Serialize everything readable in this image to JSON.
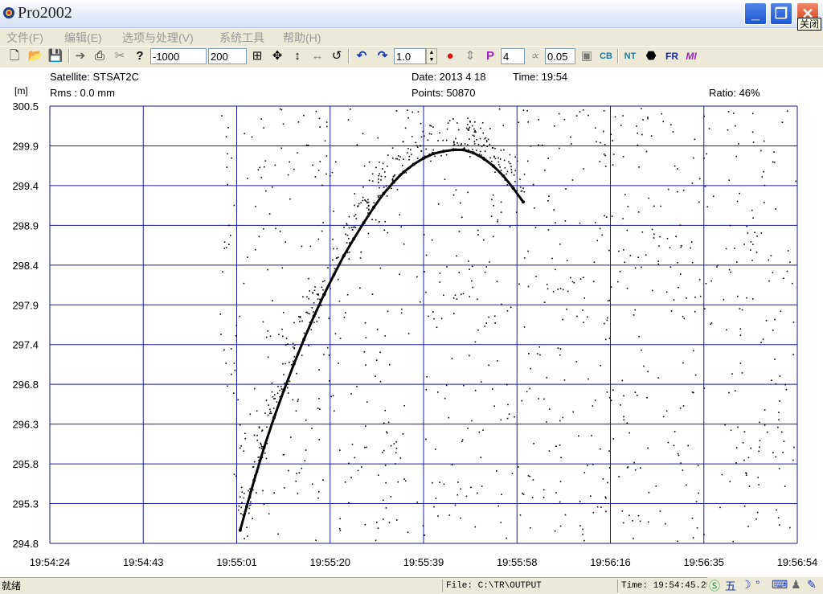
{
  "window": {
    "title": "Pro2002",
    "close_tooltip": "关闭"
  },
  "menu": [
    {
      "label": "文件(F)"
    },
    {
      "label": "编辑(E)"
    },
    {
      "label": "选项与处理(V)"
    },
    {
      "label": "系统工具"
    },
    {
      "label": "帮助(H)"
    }
  ],
  "toolbar": {
    "start_value": "-1000",
    "range_value": "200",
    "step_value": "1.0",
    "p_value": "4",
    "tolerance_value": "0.05",
    "icons": [
      "new-icon",
      "open-icon",
      "save-icon",
      "forward-icon",
      "print-icon",
      "cut-icon",
      "help-icon",
      "zoom-fit-icon",
      "pan-icon",
      "vertical-scale-icon",
      "horizontal-scale-icon",
      "rotate-icon",
      "undo-icon",
      "redo-icon",
      "record-dot-icon",
      "vertical-move-icon",
      "p-label-icon",
      "x-icon",
      "disk-icon",
      "cb-icon",
      "nt-icon",
      "point-icon",
      "fr-icon",
      "mi-icon"
    ],
    "p_label": "P",
    "cb_label": "CB",
    "nt_label": "NT",
    "fr_label": "FR",
    "mi_label": "MI"
  },
  "info": {
    "unit": "[m]",
    "satellite": "Satellite: STSAT2C",
    "rms": "Rms :   0.0 mm",
    "date": "Date: 2013  4 18",
    "time": "Time: 19:54",
    "points": "Points: 50870",
    "ratio": "Ratio:  46%"
  },
  "chart_data": {
    "type": "scatter",
    "title": "",
    "xlabel": "",
    "ylabel": "[m]",
    "x_tick_labels": [
      "19:54:24",
      "19:54:43",
      "19:55:01",
      "19:55:20",
      "19:55:39",
      "19:55:58",
      "19:56:16",
      "19:56:35",
      "19:56:54"
    ],
    "y_tick_labels": [
      "300.5",
      "299.9",
      "299.4",
      "298.9",
      "298.4",
      "297.9",
      "297.4",
      "296.8",
      "296.3",
      "295.8",
      "295.3",
      "294.8"
    ],
    "xlim_seconds_after_19_54_24": [
      0,
      150
    ],
    "ylim": [
      294.8,
      300.5
    ],
    "grid": true,
    "point_color": "#000000",
    "grid_color": "#1a1aa8",
    "series": [
      {
        "values": [
          [
            38.2,
            294.97
          ],
          [
            39.5,
            295.28
          ],
          [
            41.0,
            295.62
          ],
          [
            43.0,
            296.05
          ],
          [
            45.0,
            296.44
          ],
          [
            47.0,
            296.8
          ],
          [
            49.0,
            297.14
          ],
          [
            51.0,
            297.46
          ],
          [
            53.0,
            297.76
          ],
          [
            55.0,
            298.04
          ],
          [
            57.0,
            298.3
          ],
          [
            59.0,
            298.55
          ],
          [
            61.0,
            298.77
          ],
          [
            63.0,
            298.98
          ],
          [
            65.0,
            299.18
          ],
          [
            67.0,
            299.36
          ],
          [
            69.0,
            299.51
          ],
          [
            71.0,
            299.64
          ],
          [
            73.0,
            299.74
          ],
          [
            75.0,
            299.82
          ],
          [
            77.0,
            299.88
          ],
          [
            79.0,
            299.91
          ],
          [
            81.0,
            299.93
          ],
          [
            83.0,
            299.93
          ],
          [
            85.0,
            299.89
          ],
          [
            87.0,
            299.82
          ],
          [
            89.0,
            299.72
          ],
          [
            91.0,
            299.59
          ],
          [
            93.0,
            299.43
          ],
          [
            95.0,
            299.25
          ]
        ]
      }
    ]
  },
  "status": {
    "ready": "就绪",
    "file": "File: C:\\TR\\OUTPUT",
    "time": "Time: 19:54:45.258"
  }
}
